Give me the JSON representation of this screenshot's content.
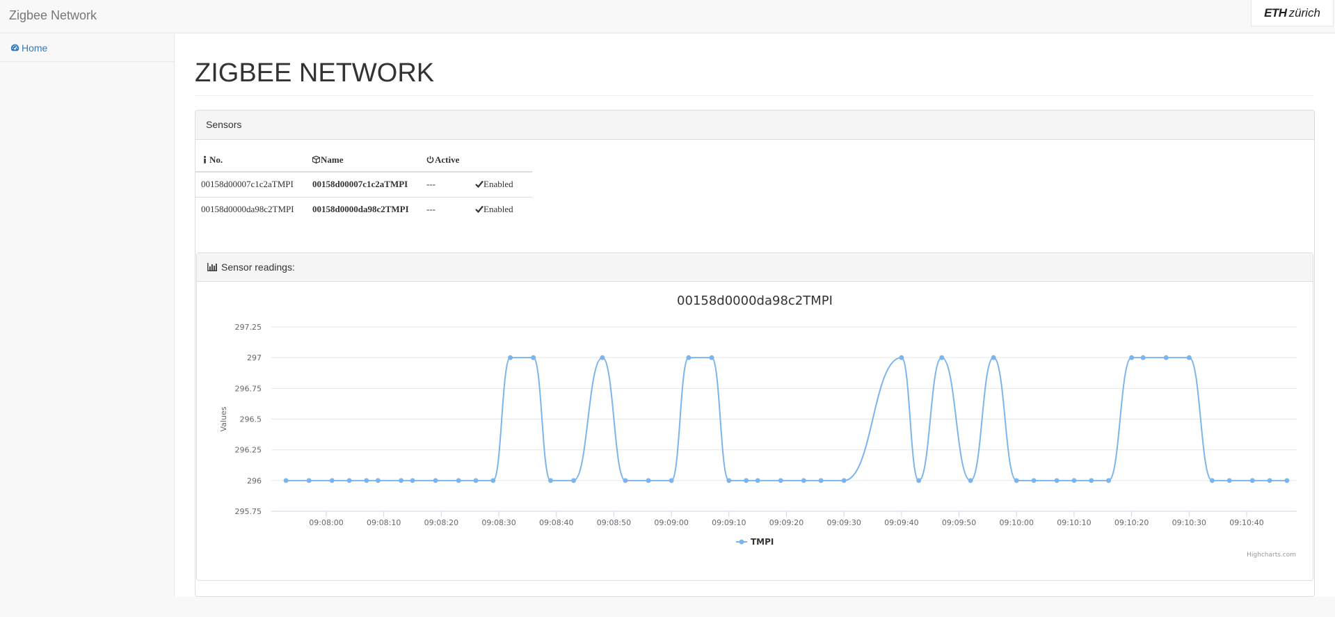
{
  "navbar": {
    "brand": "Zigbee Network",
    "logo_bold": "ETH",
    "logo_rest": "zürich"
  },
  "sidebar": {
    "items": [
      {
        "label": "Home",
        "icon": "dashboard-icon"
      }
    ]
  },
  "page": {
    "title": "ZIGBEE NETWORK"
  },
  "sensors_panel": {
    "heading": "Sensors",
    "columns": [
      {
        "label": "No.",
        "icon": "info-icon"
      },
      {
        "label": "Name",
        "icon": "cube-icon"
      },
      {
        "label": "Active",
        "icon": "power-icon"
      },
      {
        "label": ""
      }
    ],
    "rows": [
      {
        "no": "00158d00007c1c2aTMPI",
        "name": "00158d00007c1c2aTMPI",
        "active": "---",
        "status": "Enabled"
      },
      {
        "no": "00158d0000da98c2TMPI",
        "name": "00158d0000da98c2TMPI",
        "active": "---",
        "status": "Enabled"
      }
    ]
  },
  "readings_panel": {
    "heading": "Sensor readings:",
    "icon": "bar-chart-icon"
  },
  "colors": {
    "series": "#7cb5ec",
    "link": "#337ab7",
    "enabled": "#008000"
  },
  "chart_data": {
    "type": "line",
    "title": "00158d0000da98c2TMPI",
    "ylabel": "Values",
    "xlabel": "",
    "ylim": [
      295.75,
      297.25
    ],
    "yticks": [
      295.75,
      296,
      296.25,
      296.5,
      296.75,
      297,
      297.25
    ],
    "xticks": [
      "09:08:00",
      "09:08:10",
      "09:08:20",
      "09:08:30",
      "09:08:40",
      "09:08:50",
      "09:09:00",
      "09:09:10",
      "09:09:20",
      "09:09:30",
      "09:09:40",
      "09:09:50",
      "09:10:00",
      "09:10:10",
      "09:10:20",
      "09:10:30",
      "09:10:40"
    ],
    "grid": true,
    "legend": "bottom-center",
    "credits": "Highcharts.com",
    "series": [
      {
        "name": "TMPI",
        "x": [
          "09:07:53",
          "09:07:57",
          "09:08:01",
          "09:08:04",
          "09:08:07",
          "09:08:09",
          "09:08:13",
          "09:08:15",
          "09:08:19",
          "09:08:23",
          "09:08:26",
          "09:08:29",
          "09:08:32",
          "09:08:36",
          "09:08:39",
          "09:08:43",
          "09:08:48",
          "09:08:52",
          "09:08:56",
          "09:09:00",
          "09:09:03",
          "09:09:07",
          "09:09:10",
          "09:09:13",
          "09:09:15",
          "09:09:19",
          "09:09:23",
          "09:09:26",
          "09:09:30",
          "09:09:40",
          "09:09:43",
          "09:09:47",
          "09:09:52",
          "09:09:56",
          "09:10:00",
          "09:10:03",
          "09:10:07",
          "09:10:10",
          "09:10:13",
          "09:10:16",
          "09:10:20",
          "09:10:22",
          "09:10:26",
          "09:10:30",
          "09:10:34",
          "09:10:37",
          "09:10:41",
          "09:10:44",
          "09:10:47"
        ],
        "values": [
          296,
          296,
          296,
          296,
          296,
          296,
          296,
          296,
          296,
          296,
          296,
          296,
          297,
          297,
          296,
          296,
          297,
          296,
          296,
          296,
          297,
          297,
          296,
          296,
          296,
          296,
          296,
          296,
          296,
          297,
          296,
          297,
          296,
          297,
          296,
          296,
          296,
          296,
          296,
          296,
          297,
          297,
          297,
          297,
          296,
          296,
          296,
          296,
          296
        ]
      }
    ]
  }
}
